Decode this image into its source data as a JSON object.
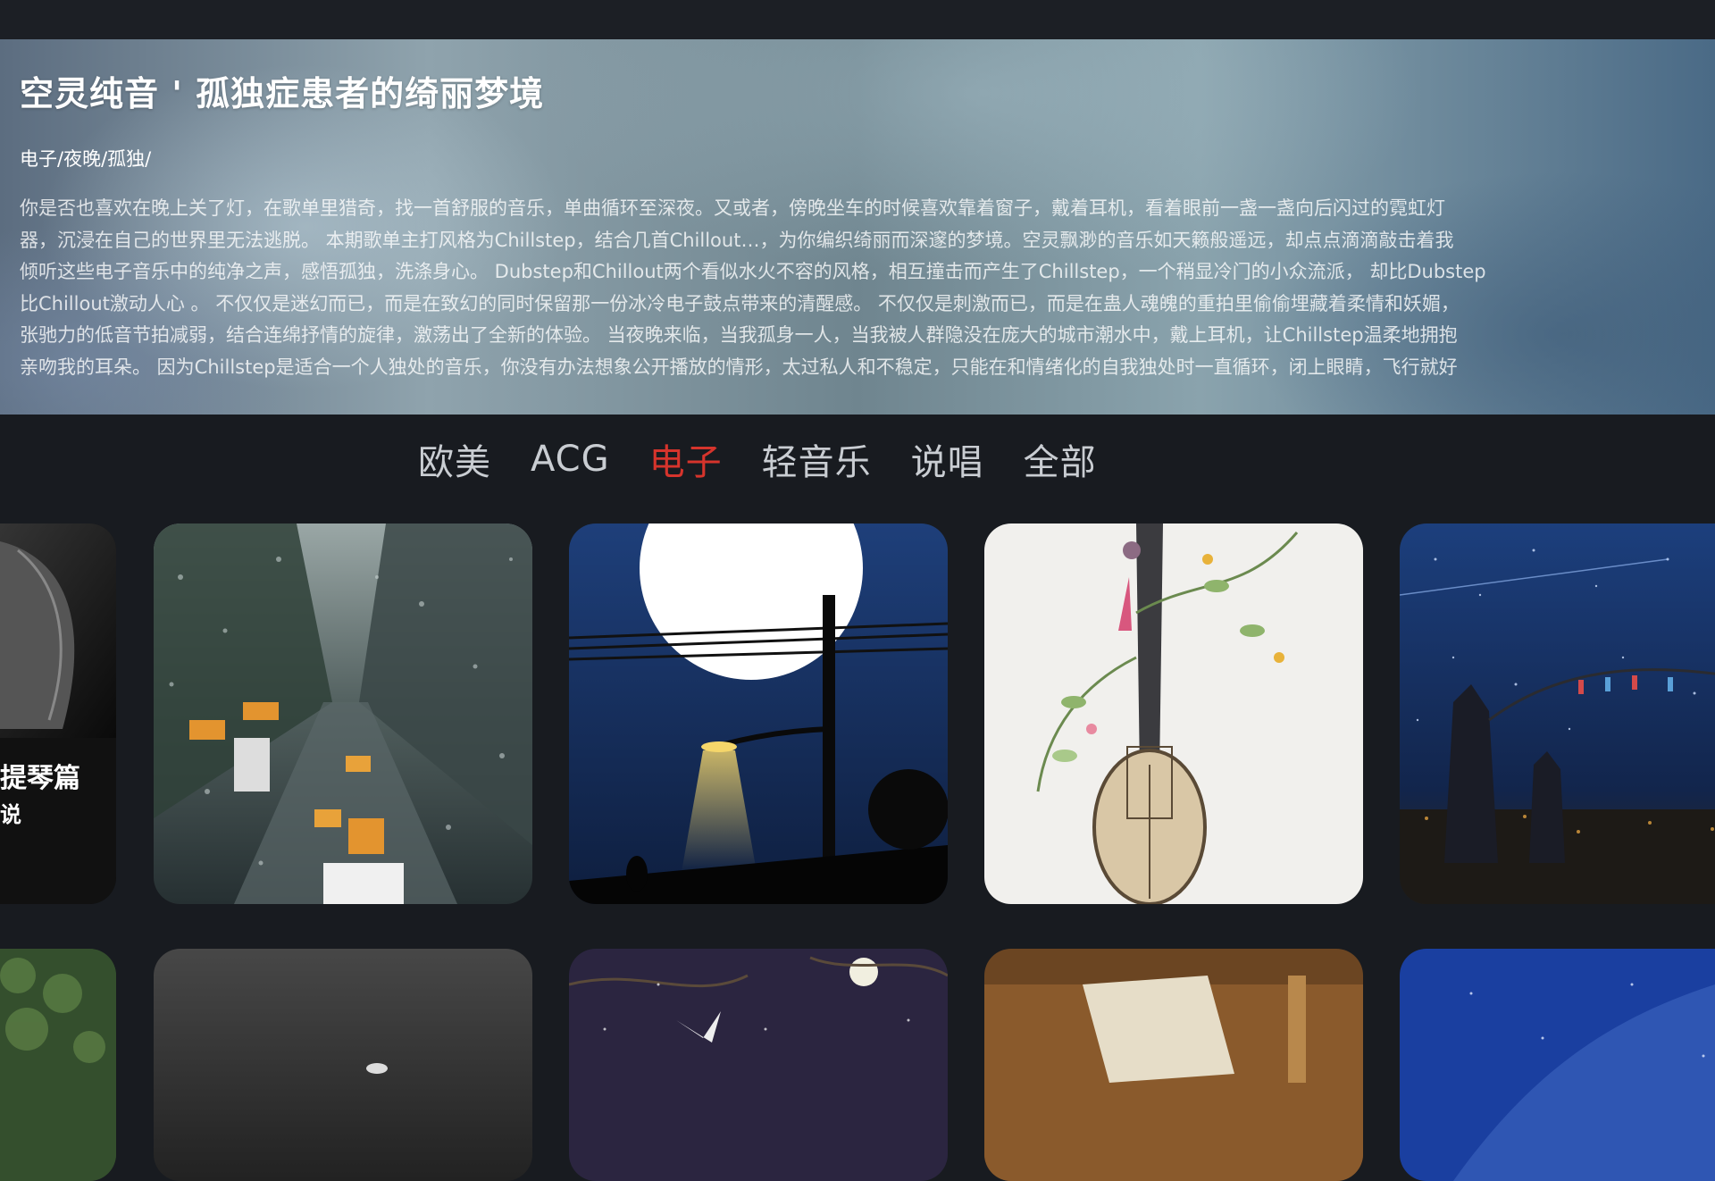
{
  "hero": {
    "title": "空灵纯音 ' 孤独症患者的绮丽梦境",
    "tags": "电子/夜晚/孤独/",
    "description_lines": [
      "你是否也喜欢在晚上关了灯，在歌单里猎奇，找一首舒服的音乐，单曲循环至深夜。又或者，傍晚坐车的时候喜欢靠着窗子，戴着耳机，看着眼前一盏一盏向后闪过的霓虹灯",
      "器，沉浸在自己的世界里无法逃脱。 本期歌单主打风格为Chillstep，结合几首Chillout…，为你编织绮丽而深邃的梦境。空灵飘渺的音乐如天籁般遥远，却点点滴滴敲击着我",
      "倾听这些电子音乐中的纯净之声，感悟孤独，洗涤身心。 Dubstep和Chillout两个看似水火不容的风格，相互撞击而产生了Chillstep，一个稍显冷门的小众流派， 却比Dubstep",
      "比Chillout激动人心 。 不仅仅是迷幻而已，而是在致幻的同时保留那一份冰冷电子鼓点带来的清醒感。 不仅仅是刺激而已，而是在蛊人魂魄的重拍里偷偷埋藏着柔情和妖媚，",
      "张驰力的低音节拍减弱，结合连绵抒情的旋律，激荡出了全新的体验。 当夜晚来临，当我孤身一人，当我被人群隐没在庞大的城市潮水中，戴上耳机，让Chillstep温柔地拥抱",
      "亲吻我的耳朵。 因为Chillstep是适合一个人独处的音乐，你没有办法想象公开播放的情形，太过私人和不稳定，只能在和情绪化的自我独处时一直循环，闭上眼睛，飞行就好"
    ]
  },
  "tabs": [
    {
      "label": "欧美",
      "active": false
    },
    {
      "label": "ACG",
      "active": false
    },
    {
      "label": "电子",
      "active": true
    },
    {
      "label": "轻音乐",
      "active": false
    },
    {
      "label": "说唱",
      "active": false
    },
    {
      "label": "全部",
      "active": false
    }
  ],
  "cards_row1": {
    "partial_left_title": "提琴篇",
    "partial_left_subtitle": "说"
  },
  "colors": {
    "background": "#181b20",
    "active_tab": "#d6342c",
    "inactive_tab": "#c9cdd2"
  }
}
